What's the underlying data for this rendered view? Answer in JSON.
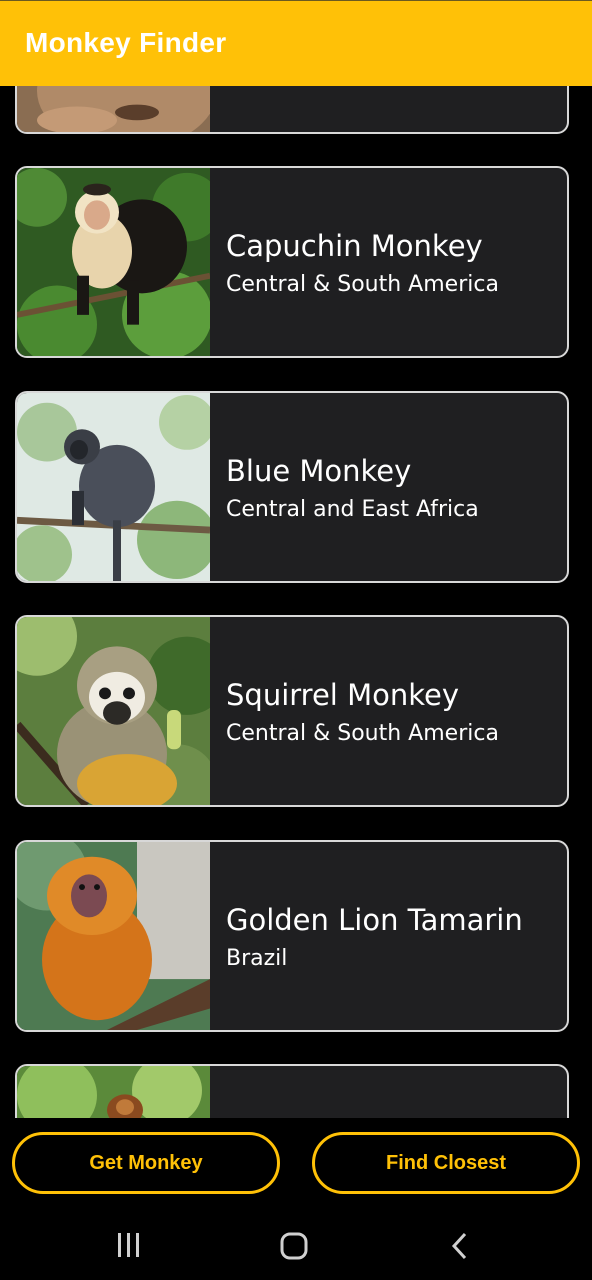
{
  "app": {
    "title": "Monkey Finder"
  },
  "monkeys": [
    {
      "name": "",
      "location": ""
    },
    {
      "name": "Capuchin Monkey",
      "location": "Central & South America"
    },
    {
      "name": "Blue Monkey",
      "location": "Central and East Africa"
    },
    {
      "name": "Squirrel Monkey",
      "location": "Central & South America"
    },
    {
      "name": "Golden Lion Tamarin",
      "location": "Brazil"
    },
    {
      "name": "",
      "location": ""
    }
  ],
  "actions": {
    "get_monkey": "Get Monkey",
    "find_closest": "Find Closest"
  },
  "colors": {
    "accent": "#ffc107",
    "card_bg": "#1f1f21",
    "card_border": "#d8d8d8"
  },
  "system_nav": {
    "icons": [
      "recent-apps-icon",
      "home-icon",
      "back-icon"
    ]
  }
}
